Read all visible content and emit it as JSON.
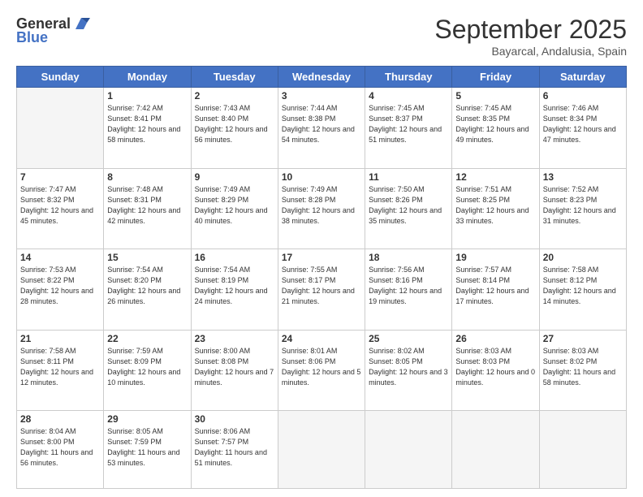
{
  "header": {
    "logo_general": "General",
    "logo_blue": "Blue",
    "month_title": "September 2025",
    "location": "Bayarcal, Andalusia, Spain"
  },
  "days_of_week": [
    "Sunday",
    "Monday",
    "Tuesday",
    "Wednesday",
    "Thursday",
    "Friday",
    "Saturday"
  ],
  "weeks": [
    [
      {
        "day": "",
        "info": ""
      },
      {
        "day": "1",
        "info": "Sunrise: 7:42 AM\nSunset: 8:41 PM\nDaylight: 12 hours\nand 58 minutes."
      },
      {
        "day": "2",
        "info": "Sunrise: 7:43 AM\nSunset: 8:40 PM\nDaylight: 12 hours\nand 56 minutes."
      },
      {
        "day": "3",
        "info": "Sunrise: 7:44 AM\nSunset: 8:38 PM\nDaylight: 12 hours\nand 54 minutes."
      },
      {
        "day": "4",
        "info": "Sunrise: 7:45 AM\nSunset: 8:37 PM\nDaylight: 12 hours\nand 51 minutes."
      },
      {
        "day": "5",
        "info": "Sunrise: 7:45 AM\nSunset: 8:35 PM\nDaylight: 12 hours\nand 49 minutes."
      },
      {
        "day": "6",
        "info": "Sunrise: 7:46 AM\nSunset: 8:34 PM\nDaylight: 12 hours\nand 47 minutes."
      }
    ],
    [
      {
        "day": "7",
        "info": "Sunrise: 7:47 AM\nSunset: 8:32 PM\nDaylight: 12 hours\nand 45 minutes."
      },
      {
        "day": "8",
        "info": "Sunrise: 7:48 AM\nSunset: 8:31 PM\nDaylight: 12 hours\nand 42 minutes."
      },
      {
        "day": "9",
        "info": "Sunrise: 7:49 AM\nSunset: 8:29 PM\nDaylight: 12 hours\nand 40 minutes."
      },
      {
        "day": "10",
        "info": "Sunrise: 7:49 AM\nSunset: 8:28 PM\nDaylight: 12 hours\nand 38 minutes."
      },
      {
        "day": "11",
        "info": "Sunrise: 7:50 AM\nSunset: 8:26 PM\nDaylight: 12 hours\nand 35 minutes."
      },
      {
        "day": "12",
        "info": "Sunrise: 7:51 AM\nSunset: 8:25 PM\nDaylight: 12 hours\nand 33 minutes."
      },
      {
        "day": "13",
        "info": "Sunrise: 7:52 AM\nSunset: 8:23 PM\nDaylight: 12 hours\nand 31 minutes."
      }
    ],
    [
      {
        "day": "14",
        "info": "Sunrise: 7:53 AM\nSunset: 8:22 PM\nDaylight: 12 hours\nand 28 minutes."
      },
      {
        "day": "15",
        "info": "Sunrise: 7:54 AM\nSunset: 8:20 PM\nDaylight: 12 hours\nand 26 minutes."
      },
      {
        "day": "16",
        "info": "Sunrise: 7:54 AM\nSunset: 8:19 PM\nDaylight: 12 hours\nand 24 minutes."
      },
      {
        "day": "17",
        "info": "Sunrise: 7:55 AM\nSunset: 8:17 PM\nDaylight: 12 hours\nand 21 minutes."
      },
      {
        "day": "18",
        "info": "Sunrise: 7:56 AM\nSunset: 8:16 PM\nDaylight: 12 hours\nand 19 minutes."
      },
      {
        "day": "19",
        "info": "Sunrise: 7:57 AM\nSunset: 8:14 PM\nDaylight: 12 hours\nand 17 minutes."
      },
      {
        "day": "20",
        "info": "Sunrise: 7:58 AM\nSunset: 8:12 PM\nDaylight: 12 hours\nand 14 minutes."
      }
    ],
    [
      {
        "day": "21",
        "info": "Sunrise: 7:58 AM\nSunset: 8:11 PM\nDaylight: 12 hours\nand 12 minutes."
      },
      {
        "day": "22",
        "info": "Sunrise: 7:59 AM\nSunset: 8:09 PM\nDaylight: 12 hours\nand 10 minutes."
      },
      {
        "day": "23",
        "info": "Sunrise: 8:00 AM\nSunset: 8:08 PM\nDaylight: 12 hours\nand 7 minutes."
      },
      {
        "day": "24",
        "info": "Sunrise: 8:01 AM\nSunset: 8:06 PM\nDaylight: 12 hours\nand 5 minutes."
      },
      {
        "day": "25",
        "info": "Sunrise: 8:02 AM\nSunset: 8:05 PM\nDaylight: 12 hours\nand 3 minutes."
      },
      {
        "day": "26",
        "info": "Sunrise: 8:03 AM\nSunset: 8:03 PM\nDaylight: 12 hours\nand 0 minutes."
      },
      {
        "day": "27",
        "info": "Sunrise: 8:03 AM\nSunset: 8:02 PM\nDaylight: 11 hours\nand 58 minutes."
      }
    ],
    [
      {
        "day": "28",
        "info": "Sunrise: 8:04 AM\nSunset: 8:00 PM\nDaylight: 11 hours\nand 56 minutes."
      },
      {
        "day": "29",
        "info": "Sunrise: 8:05 AM\nSunset: 7:59 PM\nDaylight: 11 hours\nand 53 minutes."
      },
      {
        "day": "30",
        "info": "Sunrise: 8:06 AM\nSunset: 7:57 PM\nDaylight: 11 hours\nand 51 minutes."
      },
      {
        "day": "",
        "info": ""
      },
      {
        "day": "",
        "info": ""
      },
      {
        "day": "",
        "info": ""
      },
      {
        "day": "",
        "info": ""
      }
    ]
  ]
}
